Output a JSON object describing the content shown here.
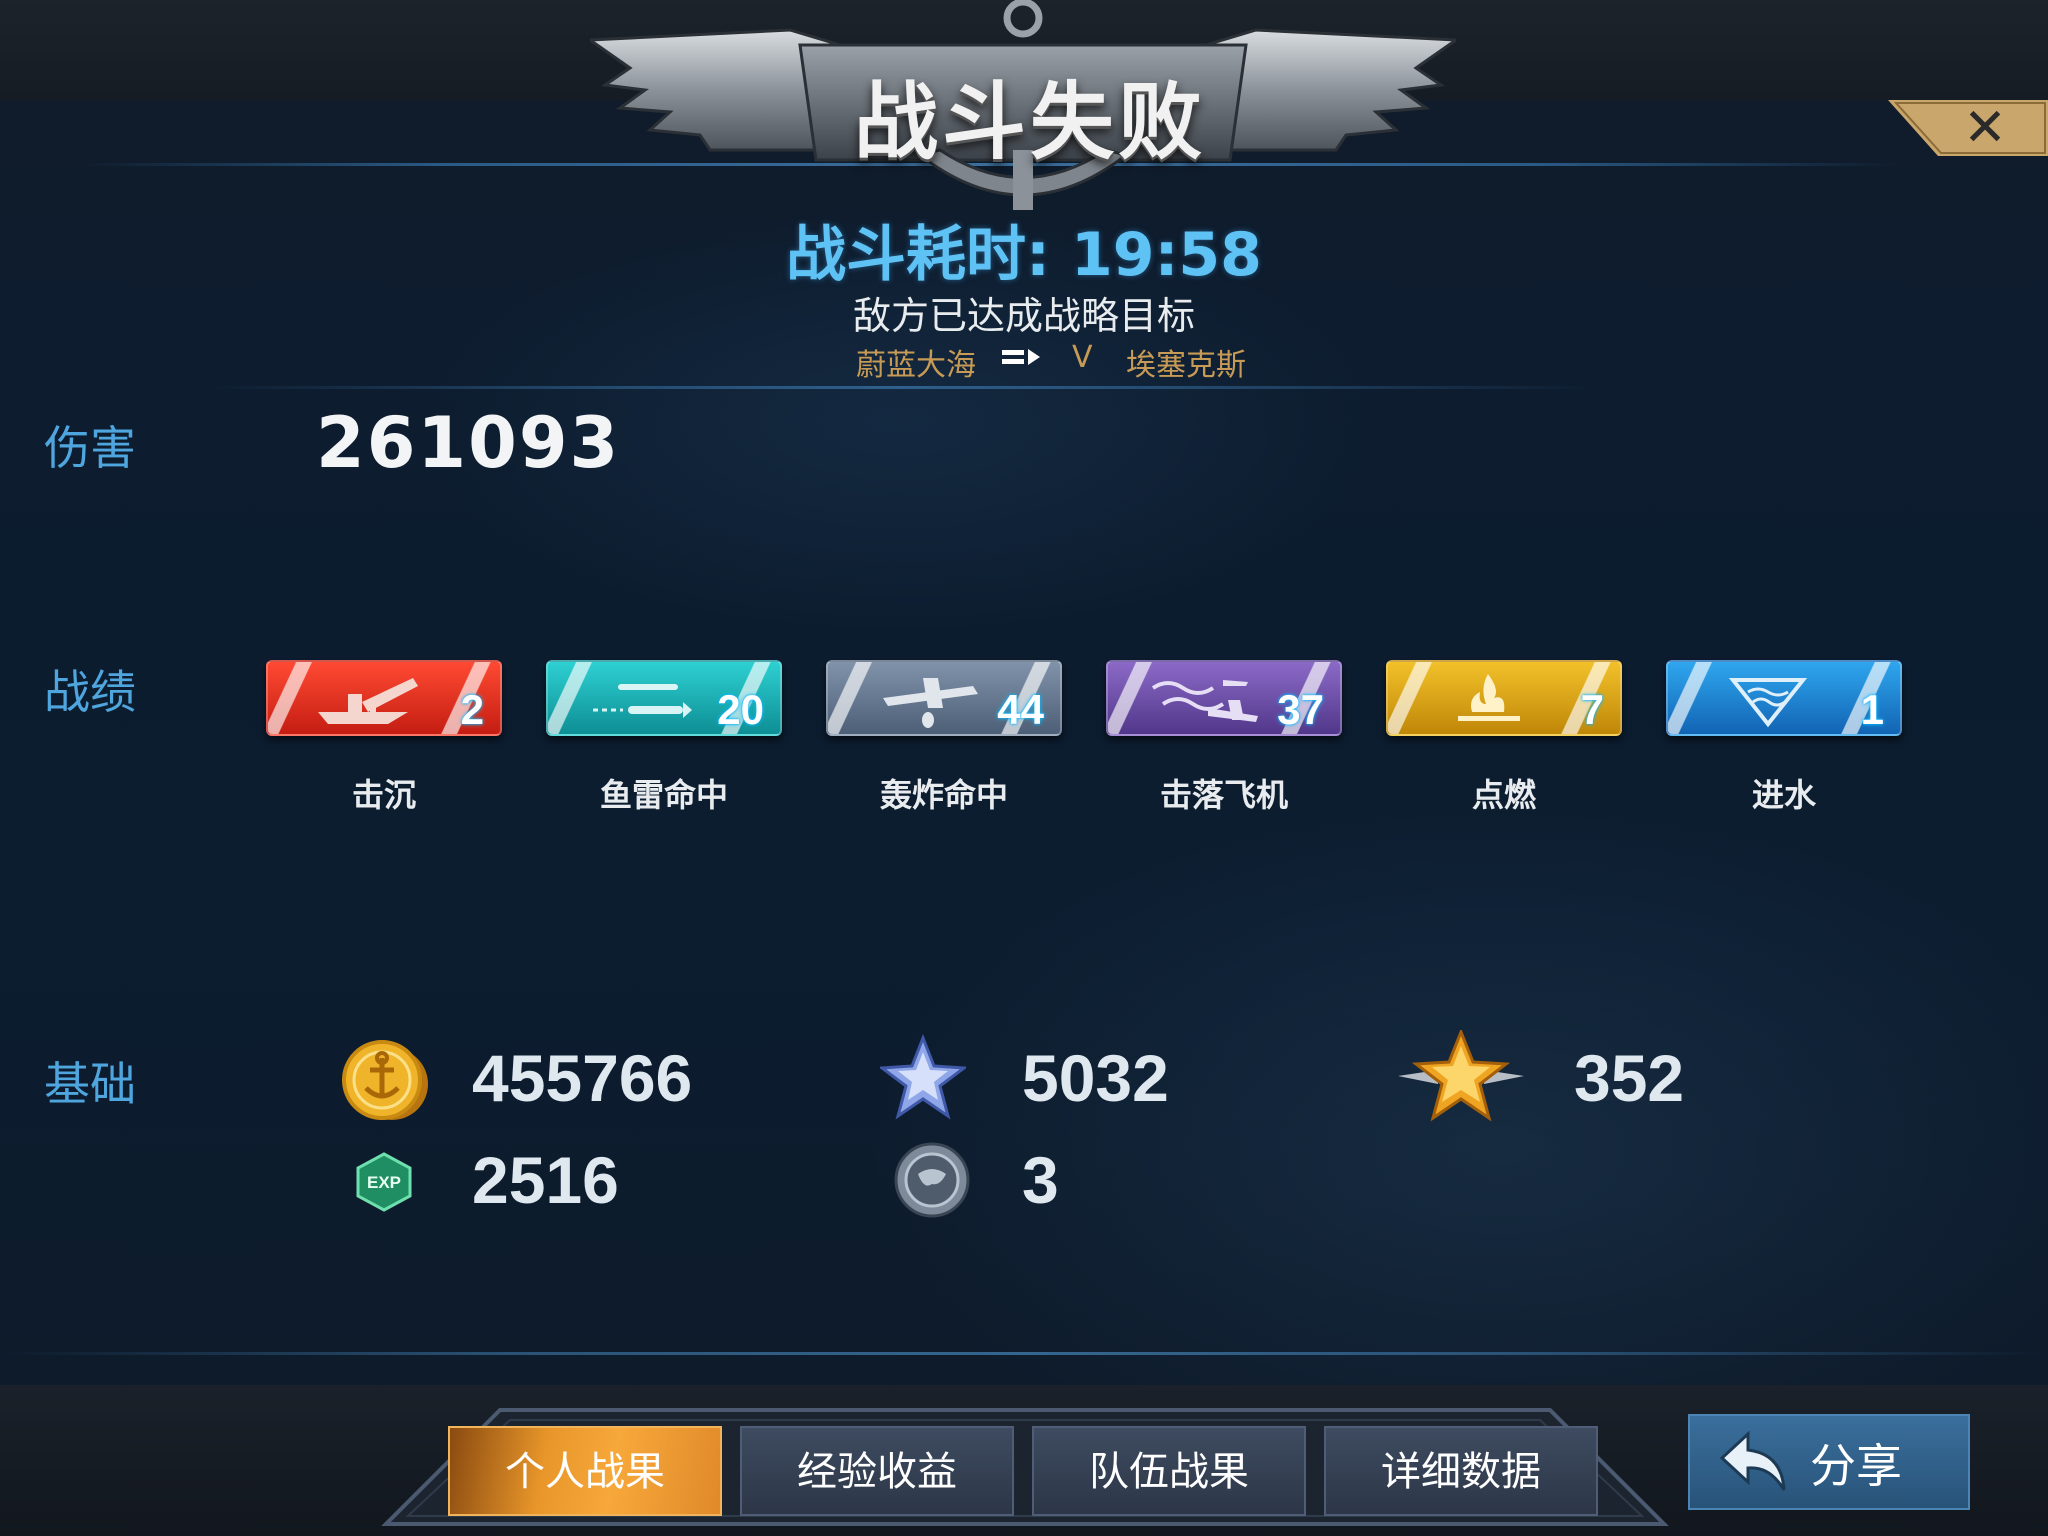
{
  "header": {
    "title": "战斗失败",
    "close_icon": "close-icon"
  },
  "battle": {
    "duration": "战斗耗时: 19:58",
    "reason": "敌方已达成战略目标",
    "player": "蔚蓝大海",
    "route_separator": "V",
    "ship": "埃塞克斯"
  },
  "sections": {
    "damage_label": "伤害",
    "record_label": "战绩",
    "base_label": "基础"
  },
  "damage": "261093",
  "records": [
    {
      "label": "击沉",
      "count": "2",
      "color": "#d8281e",
      "icon": "ship-sink-icon"
    },
    {
      "label": "鱼雷命中",
      "count": "20",
      "color": "#14a3a8",
      "icon": "torpedo-icon"
    },
    {
      "label": "轰炸命中",
      "count": "44",
      "color": "#5d6f86",
      "icon": "bomber-icon"
    },
    {
      "label": "击落飞机",
      "count": "37",
      "color": "#6a4ea6",
      "icon": "plane-shotdown-icon"
    },
    {
      "label": "点燃",
      "count": "7",
      "color": "#d9a012",
      "icon": "fire-icon"
    },
    {
      "label": "进水",
      "count": "1",
      "color": "#1b8ad6",
      "icon": "flood-icon"
    }
  ],
  "resources": {
    "coins": "455766",
    "silver_star": "5032",
    "gold_star": "352",
    "exp": "2516",
    "globe": "3"
  },
  "tabs": [
    "个人战果",
    "经验收益",
    "队伍战果",
    "详细数据"
  ],
  "active_tab": 0,
  "share_label": "分享"
}
